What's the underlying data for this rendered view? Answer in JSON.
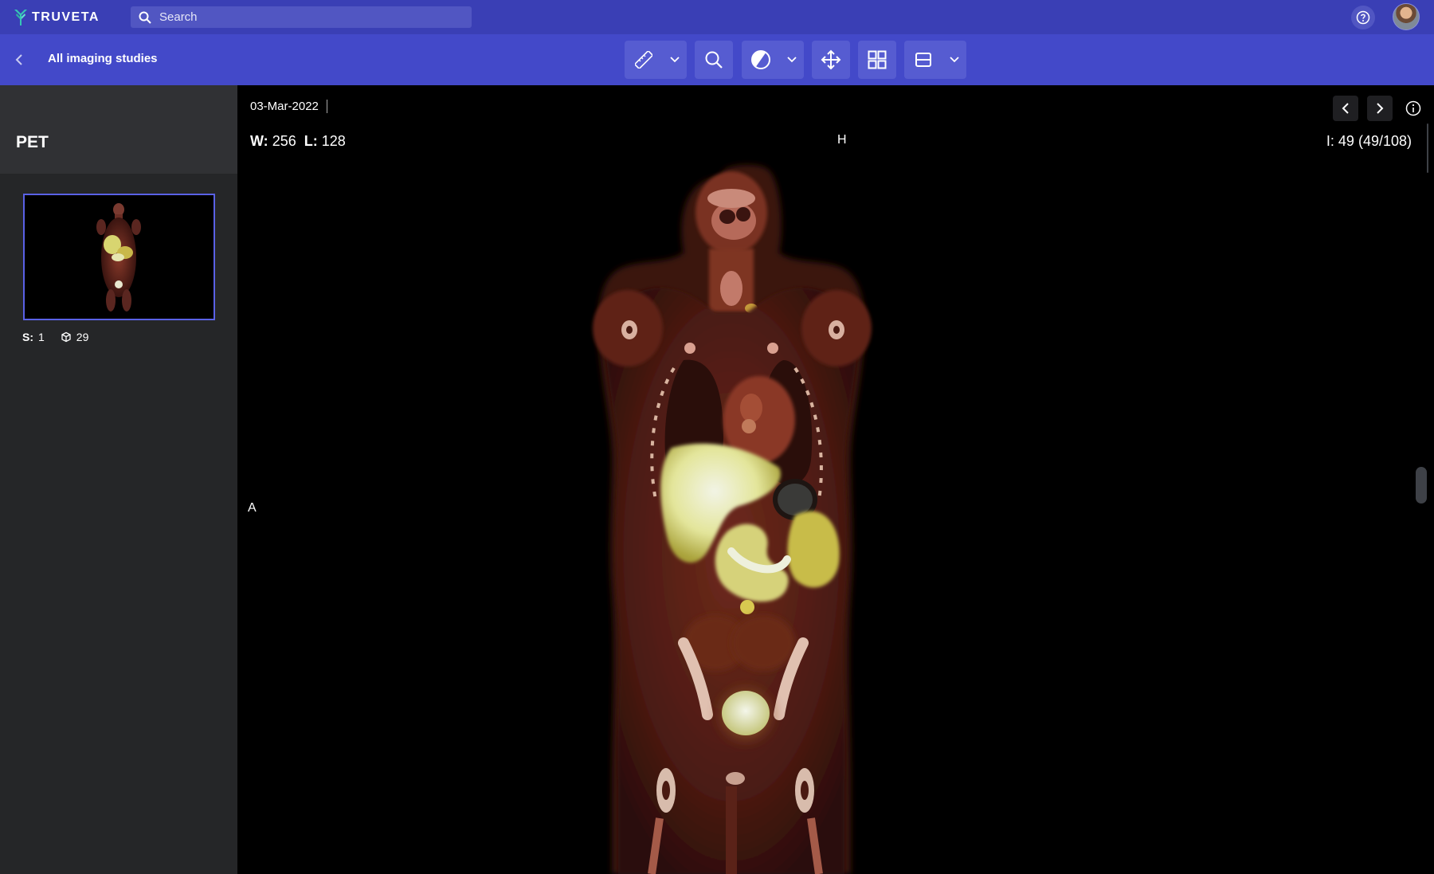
{
  "app": {
    "brand": "TRUVETA",
    "search_placeholder": "Search"
  },
  "subbar": {
    "back_label": "All imaging studies"
  },
  "toolbar": {
    "tools": [
      {
        "icon": "ruler-icon",
        "has_dropdown": true
      },
      {
        "icon": "magnifier-icon",
        "has_dropdown": false
      },
      {
        "icon": "contrast-icon",
        "has_dropdown": true
      },
      {
        "icon": "pan-icon",
        "has_dropdown": false
      },
      {
        "icon": "layout-grid-icon",
        "has_dropdown": false
      },
      {
        "icon": "series-layout-icon",
        "has_dropdown": true
      }
    ]
  },
  "sidebar": {
    "series_title": "PET",
    "thumbnail": {
      "series_label": "S:",
      "series_number": "1",
      "image_count": "29"
    }
  },
  "viewer": {
    "date": "03-Mar-2022",
    "window_label": "W:",
    "window_value": "256",
    "level_label": "L:",
    "level_value": "128",
    "orientation_top": "H",
    "orientation_left": "A",
    "image_index": "I: 49 (49/108)"
  },
  "colors": {
    "topbar": "#3a3fb5",
    "subbar": "#4349c9",
    "tool_bg": "#565cd1",
    "sidebar": "#252628",
    "selection": "#5a61e6"
  }
}
